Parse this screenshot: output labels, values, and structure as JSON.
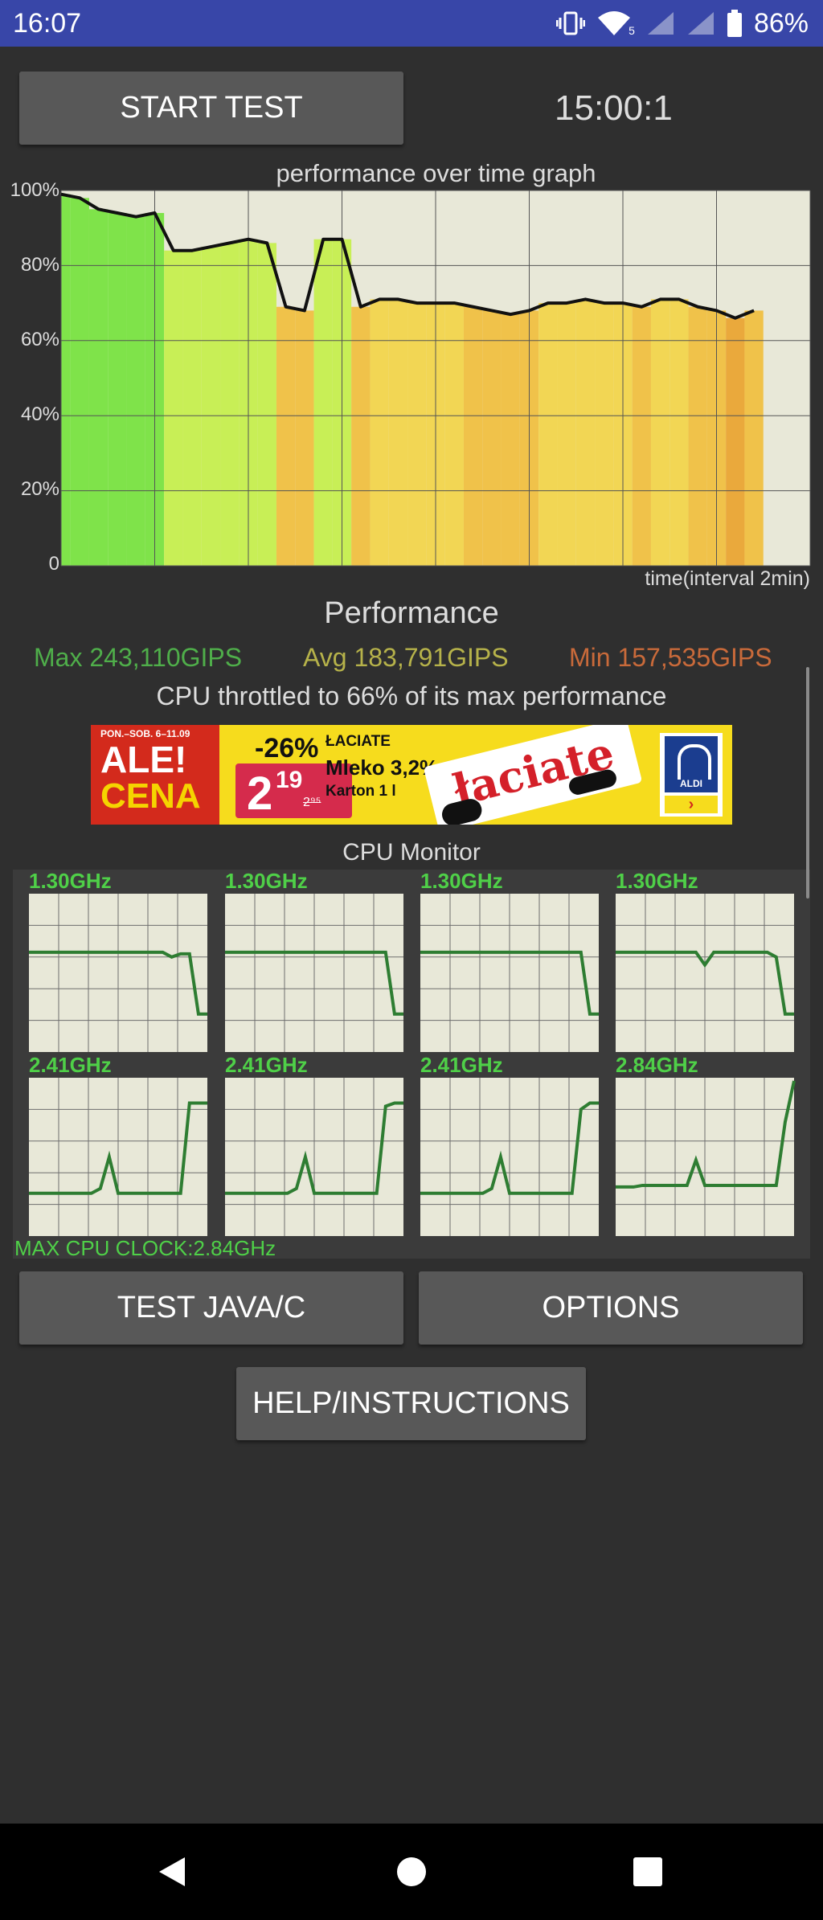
{
  "status_bar": {
    "time": "16:07",
    "battery_pct": "86%",
    "network_label": "5",
    "icons": [
      "vibrate-icon",
      "wifi-icon",
      "signal-icon",
      "signal-icon",
      "battery-icon"
    ]
  },
  "toolbar": {
    "start_label": "START TEST",
    "timer": "15:00:1"
  },
  "graph": {
    "title": "performance over time graph",
    "y_ticks": [
      "100%",
      "80%",
      "60%",
      "40%",
      "20%",
      "0"
    ],
    "x_label": "time(interval 2min)"
  },
  "chart_data": {
    "type": "line",
    "title": "performance over time graph",
    "xlabel": "time(interval 2min)",
    "ylabel": "",
    "ylim": [
      0,
      100
    ],
    "x": [
      0,
      0.2,
      0.4,
      0.6,
      0.8,
      1.0,
      1.2,
      1.4,
      1.6,
      1.8,
      2.0,
      2.2,
      2.4,
      2.6,
      2.8,
      3.0,
      3.2,
      3.4,
      3.6,
      3.8,
      4.0,
      4.2,
      4.4,
      4.6,
      4.8,
      5.0,
      5.2,
      5.4,
      5.6,
      5.8,
      6.0,
      6.2,
      6.4,
      6.6,
      6.8,
      7.0,
      7.2,
      7.4
    ],
    "series": [
      {
        "values": [
          99,
          98,
          95,
          94,
          93,
          94,
          84,
          84,
          85,
          86,
          87,
          86,
          69,
          68,
          87,
          87,
          69,
          71,
          71,
          70,
          70,
          70,
          69,
          68,
          67,
          68,
          70,
          70,
          71,
          70,
          70,
          69,
          71,
          71,
          69,
          68,
          66,
          68
        ]
      }
    ],
    "grid": true
  },
  "performance": {
    "title": "Performance",
    "max": "Max 243,110GIPS",
    "avg": "Avg 183,791GIPS",
    "min": "Min 157,535GIPS",
    "throttle": "CPU throttled to 66% of its max performance"
  },
  "ad": {
    "date_line": "PON.–SOB. 6–11.09",
    "headline_1": "ALE!",
    "headline_2": "CENA",
    "discount": "-26%",
    "price_main": "2",
    "price_cents": "19",
    "old_price": "2⁹⁵",
    "brand": "ŁACIATE",
    "product": "Mleko 3,2%",
    "pack": "Karton 1 l",
    "box_text": "łaciate",
    "store": "ALDI",
    "arrow": "›"
  },
  "cpu_monitor": {
    "title": "CPU Monitor",
    "cores": [
      {
        "freq": "1.30GHz",
        "level": [
          0.63,
          0.63,
          0.63,
          0.63,
          0.63,
          0.63,
          0.63,
          0.63,
          0.63,
          0.63,
          0.63,
          0.63,
          0.63,
          0.63,
          0.63,
          0.63,
          0.6,
          0.62,
          0.62,
          0.24,
          0.24
        ]
      },
      {
        "freq": "1.30GHz",
        "level": [
          0.63,
          0.63,
          0.63,
          0.63,
          0.63,
          0.63,
          0.63,
          0.63,
          0.63,
          0.63,
          0.63,
          0.63,
          0.63,
          0.63,
          0.63,
          0.63,
          0.63,
          0.63,
          0.63,
          0.24,
          0.24
        ]
      },
      {
        "freq": "1.30GHz",
        "level": [
          0.63,
          0.63,
          0.63,
          0.63,
          0.63,
          0.63,
          0.63,
          0.63,
          0.63,
          0.63,
          0.63,
          0.63,
          0.63,
          0.63,
          0.63,
          0.63,
          0.63,
          0.63,
          0.63,
          0.24,
          0.24
        ]
      },
      {
        "freq": "1.30GHz",
        "level": [
          0.63,
          0.63,
          0.63,
          0.63,
          0.63,
          0.63,
          0.63,
          0.63,
          0.63,
          0.63,
          0.55,
          0.63,
          0.63,
          0.63,
          0.63,
          0.63,
          0.63,
          0.63,
          0.6,
          0.24,
          0.24
        ]
      },
      {
        "freq": "2.41GHz",
        "level": [
          0.27,
          0.27,
          0.27,
          0.27,
          0.27,
          0.27,
          0.27,
          0.27,
          0.3,
          0.5,
          0.27,
          0.27,
          0.27,
          0.27,
          0.27,
          0.27,
          0.27,
          0.27,
          0.84,
          0.84,
          0.84
        ]
      },
      {
        "freq": "2.41GHz",
        "level": [
          0.27,
          0.27,
          0.27,
          0.27,
          0.27,
          0.27,
          0.27,
          0.27,
          0.3,
          0.5,
          0.27,
          0.27,
          0.27,
          0.27,
          0.27,
          0.27,
          0.27,
          0.27,
          0.82,
          0.84,
          0.84
        ]
      },
      {
        "freq": "2.41GHz",
        "level": [
          0.27,
          0.27,
          0.27,
          0.27,
          0.27,
          0.27,
          0.27,
          0.27,
          0.3,
          0.5,
          0.27,
          0.27,
          0.27,
          0.27,
          0.27,
          0.27,
          0.27,
          0.27,
          0.8,
          0.84,
          0.84
        ]
      },
      {
        "freq": "2.84GHz",
        "level": [
          0.31,
          0.31,
          0.31,
          0.32,
          0.32,
          0.32,
          0.32,
          0.32,
          0.32,
          0.48,
          0.32,
          0.32,
          0.32,
          0.32,
          0.32,
          0.32,
          0.32,
          0.32,
          0.32,
          0.72,
          0.98
        ]
      }
    ],
    "max_clock": "MAX CPU CLOCK:2.84GHz"
  },
  "actions": {
    "test_java_label": "TEST JAVA/C",
    "options_label": "OPTIONS",
    "help_label": "HELP/INSTRUCTIONS"
  },
  "nav": {
    "icons": [
      "back-icon",
      "home-icon",
      "recents-icon"
    ]
  },
  "colors": {
    "status_bar": "#3846a8",
    "background": "#2f2f2f",
    "max_green": "#4fae4a",
    "avg_yellow": "#b6b24a",
    "min_orange": "#c96a3a",
    "cpu_green": "#4fd048",
    "cpu_line": "#2e7d32"
  }
}
